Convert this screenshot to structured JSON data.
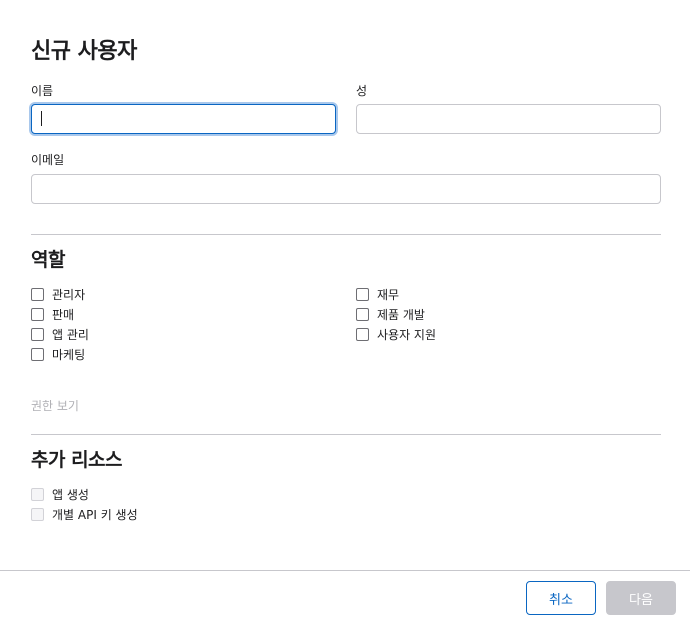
{
  "page_title": "신규 사용자",
  "form": {
    "first_name_label": "이름",
    "first_name_value": "",
    "last_name_label": "성",
    "last_name_value": "",
    "email_label": "이메일",
    "email_value": ""
  },
  "roles": {
    "title": "역할",
    "left": [
      "관리자",
      "판매",
      "앱 관리",
      "마케팅"
    ],
    "right": [
      "재무",
      "제품 개발",
      "사용자 지원"
    ],
    "view_permissions_label": "권한 보기"
  },
  "resources": {
    "title": "추가 리소스",
    "items": [
      "앱 생성",
      "개별 API 키 생성"
    ]
  },
  "footer": {
    "cancel_label": "취소",
    "next_label": "다음"
  },
  "colors": {
    "accent": "#0a66c2",
    "focus_ring": "#a9c8ec",
    "disabled_button": "#c7c7cc",
    "disabled_text": "#b0b0b5"
  }
}
